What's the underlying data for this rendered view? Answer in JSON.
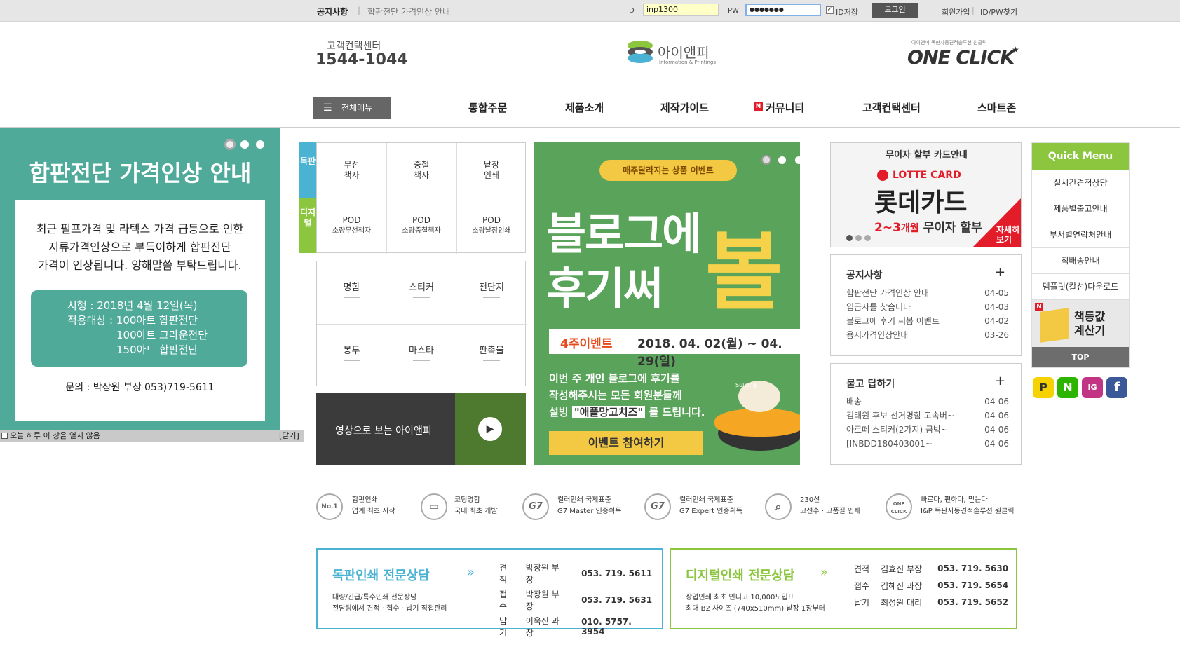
{
  "topbar": {
    "notice_label": "공지사항",
    "notice_text": "합판전단 가격인상 안내",
    "id_label": "ID",
    "id_value": "inp1300",
    "pw_label": "PW",
    "pw_value": "●●●●●●●",
    "save_id_label": "ID저장",
    "login_button": "로그인",
    "join_link": "회원가입",
    "find_link": "ID/PW찾기"
  },
  "header": {
    "cs_label": "고객컨택센터",
    "cs_phone": "1544-1044",
    "logo_text": "아이앤피",
    "logo_sub": "Information & Printings",
    "oneclick_small": "아이앤피 독판자동견적솔루션 원클릭",
    "oneclick_text": "ONE CLICK"
  },
  "nav": {
    "all_menu": "전체메뉴",
    "items": [
      "통합주문",
      "제품소개",
      "제작가이드",
      "커뮤니티",
      "고객컨택센터",
      "스마트존"
    ],
    "community_badge": "N"
  },
  "popup": {
    "title": "합판전단 가격인상 안내",
    "body": [
      "최근 펄프가격 및 라텍스 가격 급등으로 인한",
      "지류가격인상으로 부득이하게 합판전단",
      "가격이 인상됩니다. 양해말씀 부탁드립니다."
    ],
    "info_lines": [
      "시행 : 2018년 4월 12일(목)",
      "적용대상 : 100아트 합판전단",
      "100아트 크라운전단",
      "150아트 합판전단"
    ],
    "contact_label": "문의 : 박장원 부장  053)719-5611",
    "no_show_label": "오늘 하루 이 창을 열지 않음",
    "close_label": "[닫기]"
  },
  "products": {
    "offset_label": "독판",
    "digital_label": "디지털",
    "offset": [
      [
        "무선",
        "책자"
      ],
      [
        "중철",
        "책자"
      ],
      [
        "낱장",
        "인쇄"
      ]
    ],
    "digital": [
      [
        "POD",
        "소량무선책자"
      ],
      [
        "POD",
        "소량중철책자"
      ],
      [
        "POD",
        "소량낱장인쇄"
      ]
    ],
    "general": [
      "명함",
      "스티커",
      "전단지",
      "봉투",
      "마스타",
      "판촉물"
    ],
    "video_label": "영상으로 보는 아이앤피"
  },
  "event": {
    "tag": "매주달라지는 상품 이벤트",
    "line1": "블로그에",
    "line2": "후기써",
    "big_char": "볼",
    "period_label": "4주이벤트",
    "period": "2018. 04. 02(월) ~ 04. 29(일)",
    "desc1": "이번 주 개인 블로그에 후기를",
    "desc2": "작성해주시는 모든 회원분들께",
    "desc3_pre": "설빙",
    "desc3_hl": "\"애플망고치즈\"",
    "desc3_post": "를 드립니다.",
    "cta": "이벤트 참여하기",
    "bowl_text": "Sulbing"
  },
  "card_banner": {
    "top": "무이자 할부 카드안내",
    "brand_small": "LOTTE CARD",
    "brand": "롯데카드",
    "promo_num": "2~3",
    "promo_mid": "개월",
    "promo_end": "무이자 할부",
    "more": "자세히 보기"
  },
  "notice": {
    "title": "공지사항",
    "plus": "+",
    "items": [
      {
        "text": "합판전단 가격인상 안내",
        "date": "04-05"
      },
      {
        "text": "입금자를 찾습니다",
        "date": "04-03"
      },
      {
        "text": "블로그에 후기 써봄 이벤트",
        "date": "04-02"
      },
      {
        "text": "용지가격인상안내",
        "date": "03-26"
      }
    ]
  },
  "qna": {
    "title": "묻고 답하기",
    "plus": "+",
    "items": [
      {
        "text": "배송",
        "date": "04-06"
      },
      {
        "text": "김태원 후보 선거명함 고속버~",
        "date": "04-06"
      },
      {
        "text": "아르떼 스티커(2가지) 금박~",
        "date": "04-06"
      },
      {
        "text": "[INBDD180403001~",
        "date": "04-06"
      }
    ]
  },
  "quick_menu": {
    "title": "Quick Menu",
    "items": [
      "실시간견적상담",
      "제품별출고안내",
      "부서별연락처안내",
      "직배송안내",
      "템플릿(칼선)다운로드"
    ],
    "calc": "책등값 계산기",
    "calc_badge": "N",
    "top": "TOP",
    "social": [
      "P",
      "N",
      "IG",
      "f"
    ],
    "colors": {
      "title_bg": "#8cc63f",
      "top_bg": "#6d6d6d"
    }
  },
  "features": [
    {
      "icon": "No.1",
      "l1": "합판인쇄",
      "l2": "업계 최초 시작"
    },
    {
      "icon": "card",
      "l1": "코팅명함",
      "l2": "국내 최초 개발"
    },
    {
      "icon": "G7",
      "l1": "컬러인쇄 국제표준",
      "l2": "G7 Master 인증획득"
    },
    {
      "icon": "G7",
      "l1": "컬러인쇄 국제표준",
      "l2": "G7 Expert 인증획득"
    },
    {
      "icon": "230",
      "l1": "230선",
      "l2": "고선수 · 고품질 인쇄"
    },
    {
      "icon": "ONE CLICK",
      "l1": "빠르다, 편하다, 믿는다",
      "l2": "I&P 독판자동견적솔루션 원클릭"
    }
  ],
  "consult": {
    "offset": {
      "title": "독판인쇄 전문상담",
      "arrow": "»",
      "desc1": "대량/긴급/특수인쇄 전문상담",
      "desc2": "전담팀에서 견적 · 접수 · 납기 직접관리",
      "rows": [
        [
          "견적",
          "박장원 부장",
          "053. 719. 5611"
        ],
        [
          "접수",
          "박장원 부장",
          "053. 719. 5631"
        ],
        [
          "납기",
          "이욱진 과장",
          "010. 5757. 3954"
        ]
      ]
    },
    "digital": {
      "title": "디지털인쇄 전문상담",
      "arrow": "»",
      "desc1": "상업인쇄 최초 인디고 10,000도입!!",
      "desc2": "최대 B2 사이즈 (740x510mm) 낱장 1장부터",
      "rows": [
        [
          "견적",
          "김효진 부장",
          "053. 719. 5630"
        ],
        [
          "접수",
          "김혜진 과장",
          "053. 719. 5654"
        ],
        [
          "납기",
          "최성원 대리",
          "053. 719. 5652"
        ]
      ]
    }
  },
  "colors": {
    "teal": "#4faa9a",
    "green_event": "#5aa35a",
    "offset_side": "#4ab3d4",
    "digital_side": "#8cc63f",
    "card_red": "#e31c2a"
  }
}
